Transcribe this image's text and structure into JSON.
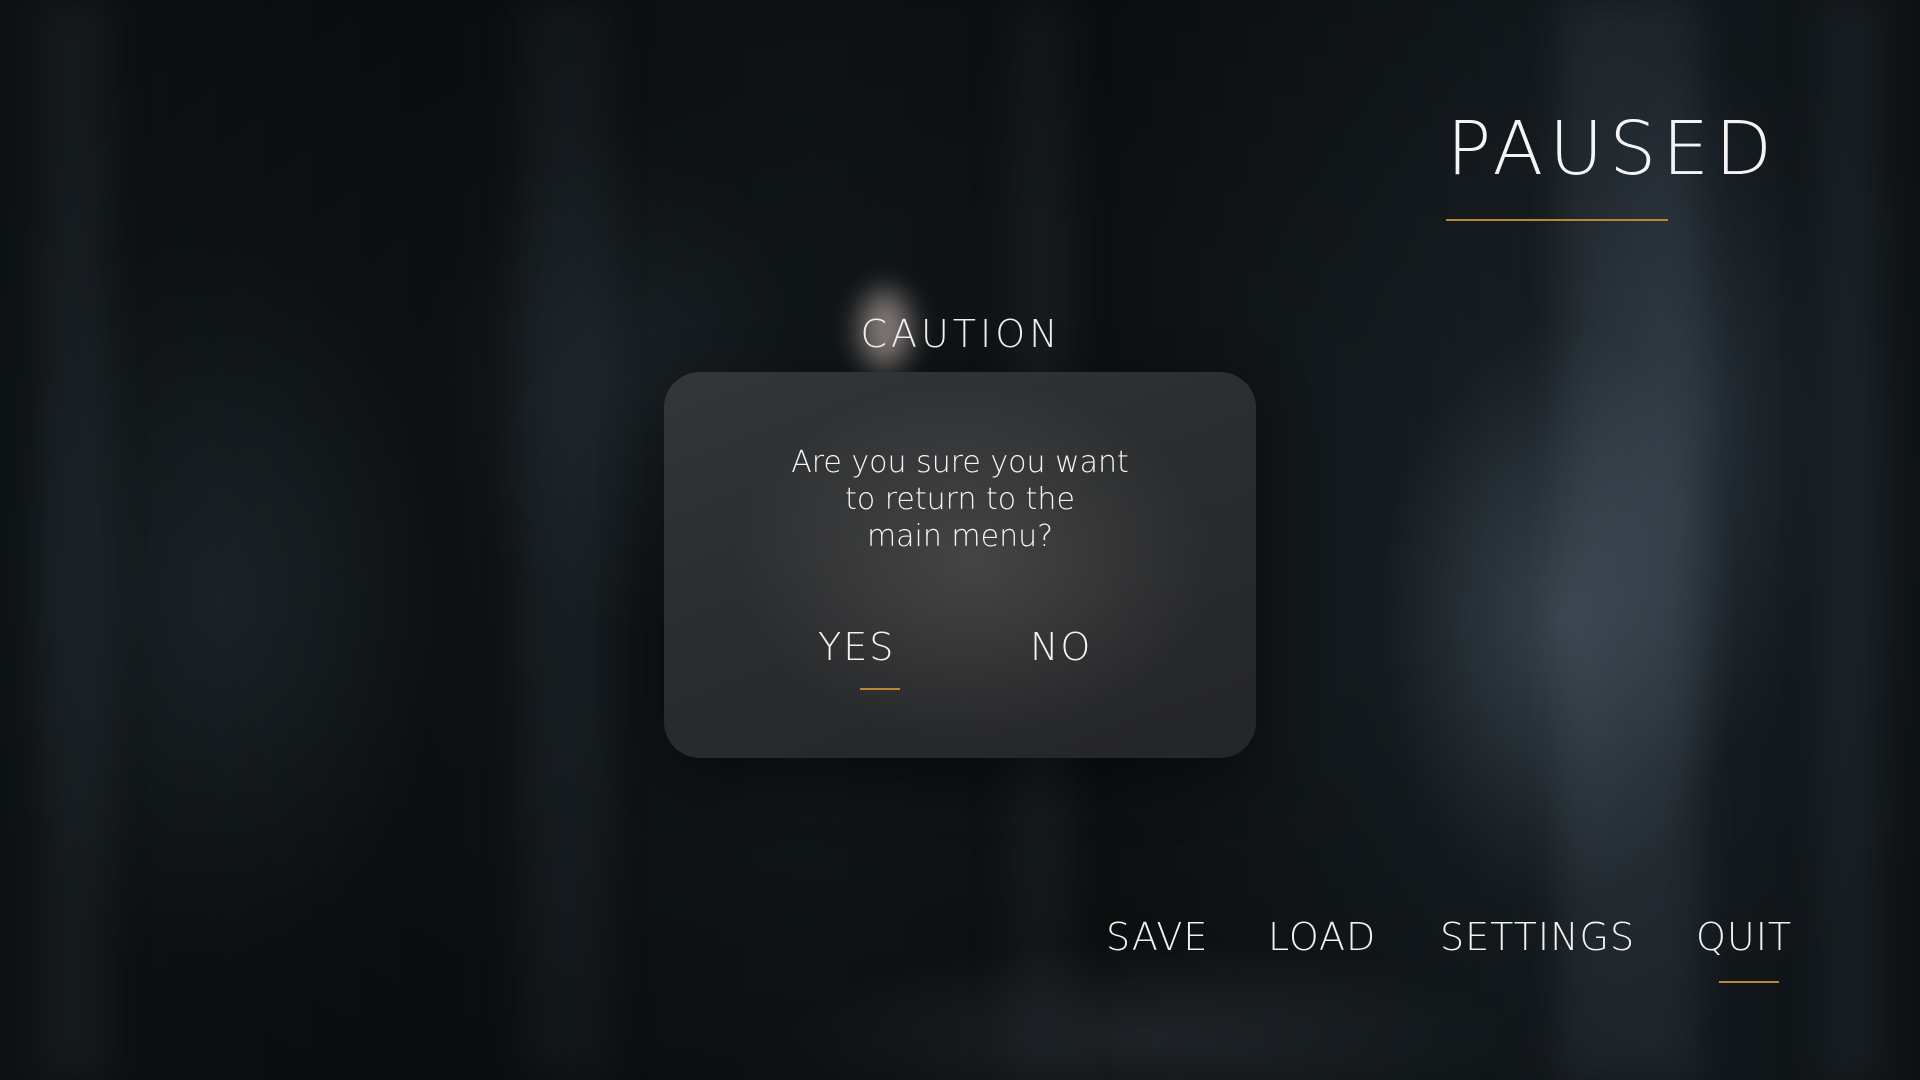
{
  "pause_screen": {
    "title": "PAUSED"
  },
  "dialog": {
    "heading": "CAUTION",
    "message": "Are you sure you want\nto return to the\nmain menu?",
    "yes_label": "YES",
    "no_label": "NO",
    "selected": "YES"
  },
  "menu": {
    "items": [
      {
        "label": "SAVE"
      },
      {
        "label": "LOAD"
      },
      {
        "label": "SETTINGS"
      },
      {
        "label": "QUIT"
      }
    ],
    "active": "QUIT"
  },
  "colors": {
    "accent": "#b8882f",
    "text": "#f2f2f2",
    "dialog_bg": "#2a2c2e"
  }
}
